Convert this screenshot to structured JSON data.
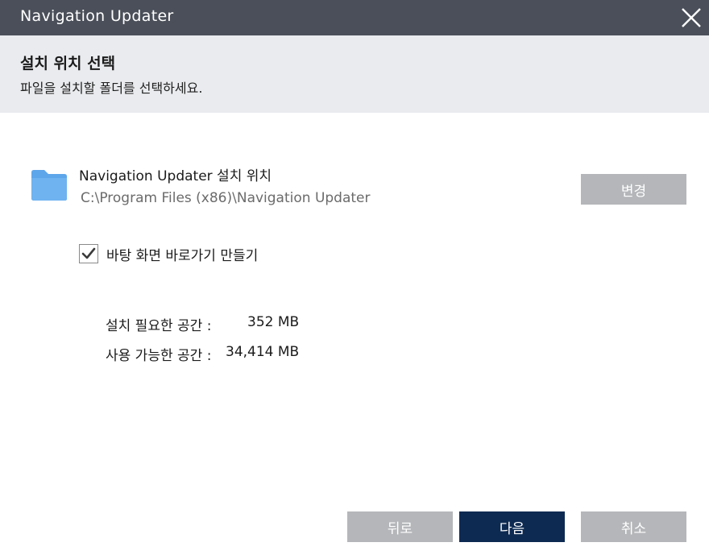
{
  "window": {
    "title": "Navigation Updater"
  },
  "header": {
    "heading": "설치 위치 선택",
    "subheading": "파일을 설치할 폴더를 선택하세요."
  },
  "install": {
    "label": "Navigation Updater 설치 위치",
    "path": "C:\\Program Files (x86)\\Navigation Updater",
    "change_label": "변경"
  },
  "shortcut": {
    "label": "바탕 화면 바로가기 만들기",
    "checked": true
  },
  "space": {
    "required_label": "설치 필요한 공간 :",
    "required_value": "352 MB",
    "available_label": "사용 가능한 공간 :",
    "available_value": "34,414 MB"
  },
  "footer": {
    "back_label": "뒤로",
    "next_label": "다음",
    "cancel_label": "취소"
  },
  "colors": {
    "titlebar": "#4a4f59",
    "header_band": "#e9ebee",
    "primary_button": "#0d2a52",
    "secondary_button": "#b4b6b9",
    "folder": "#5ea6ea"
  },
  "icons": {
    "close": "close-icon",
    "folder": "folder-icon",
    "checkmark": "checkmark-icon"
  }
}
